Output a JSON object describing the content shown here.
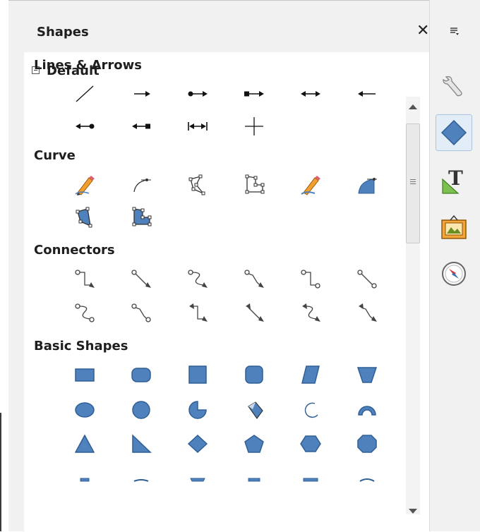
{
  "panel": {
    "title": "Shapes",
    "close_icon": "close-icon",
    "category": "Default",
    "sections": [
      {
        "title": "Lines & Arrows",
        "items": [
          "line",
          "line-ends-with-arrow",
          "line-circle-arrow",
          "line-square-arrow",
          "double-arrow",
          "line-starts-with-arrow",
          "line-starts-with-circle",
          "line-starts-with-square",
          "dimension-line",
          "cross"
        ]
      },
      {
        "title": "Curve",
        "items": [
          "freeform-line",
          "curve",
          "polygon",
          "polygon-45",
          "freeform-line-filled",
          "curve-filled",
          "polygon-filled",
          "polygon-45-filled"
        ]
      },
      {
        "title": "Connectors",
        "items": [
          "connector-ends-with-arrow",
          "straight-connector-ends-with-arrow",
          "curved-connector-ends-with-arrow",
          "line-connector-ends-with-arrow",
          "connector-ends-with-circle",
          "straight-connector-ends-with-circle",
          "curved-connector-ends-with-circle",
          "line-connector-ends-with-circle",
          "connector-with-arrows",
          "straight-connector-with-arrows",
          "curved-connector-with-arrows",
          "line-connector-with-arrows"
        ]
      },
      {
        "title": "Basic Shapes",
        "items": [
          "rectangle",
          "rounded-rectangle",
          "square",
          "rounded-square",
          "parallelogram",
          "trapezoid",
          "ellipse",
          "circle",
          "circle-pie",
          "block-arc",
          "arc",
          "half-circle",
          "isosceles-triangle",
          "right-triangle",
          "diamond",
          "pentagon",
          "hexagon",
          "octagon",
          "cylinder",
          "cube",
          "folded-corner",
          "frame",
          "octagon-bevel",
          "can"
        ]
      }
    ]
  },
  "sidebar": {
    "menu_icon": "sidebar-menu-icon",
    "tabs": [
      {
        "icon": "properties-wrench-icon",
        "active": false
      },
      {
        "icon": "shapes-diamond-icon",
        "active": true
      },
      {
        "icon": "styles-icon",
        "active": false
      },
      {
        "icon": "gallery-icon",
        "active": false
      },
      {
        "icon": "navigator-icon",
        "active": false
      }
    ]
  },
  "colors": {
    "shape_fill": "#4f81bd",
    "shape_stroke": "#2f5f95",
    "active_tab": "#e3edf8"
  }
}
